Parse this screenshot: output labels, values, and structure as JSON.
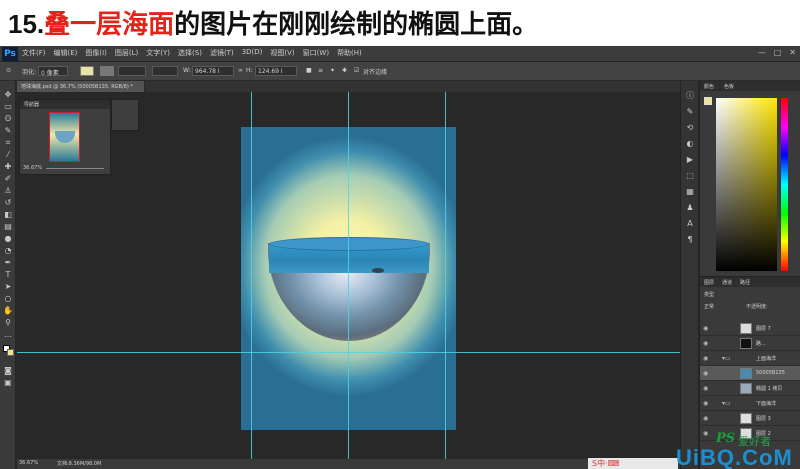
{
  "banner": {
    "number": "15.",
    "highlight": "叠一层海面",
    "rest": "的图片在刚刚绘制的椭圆上面。"
  },
  "app": {
    "logo": "Ps",
    "menu": [
      "文件(F)",
      "编辑(E)",
      "图像(I)",
      "图层(L)",
      "文字(Y)",
      "选择(S)",
      "滤镜(T)",
      "3D(D)",
      "视图(V)",
      "窗口(W)",
      "帮助(H)"
    ],
    "window_controls": [
      "—",
      "□",
      "✕"
    ]
  },
  "options_bar": {
    "style_label": "羽化:",
    "style_value": "0 像素",
    "w_label": "W:",
    "w_value": "964.78 I",
    "h_label": "H:",
    "h_value": "124.69 I",
    "align_label": "对齐边缘"
  },
  "document": {
    "tab_label": "地球海底.psd @ 36.7% (50005B135, RGB/8) *"
  },
  "navigator": {
    "title": "导航器",
    "zoom": "36.67%"
  },
  "color_panel": {
    "tabs": [
      "颜色",
      "色板"
    ]
  },
  "layers_panel": {
    "tabs": [
      "图层",
      "通道",
      "路径"
    ],
    "kind_label": "类型",
    "blend_mode": "正常",
    "opacity_label": "不透明度:",
    "rows": [
      {
        "name": "图层 7",
        "group": false
      },
      {
        "name": "路...",
        "group": false
      },
      {
        "name": "上面海洋",
        "group": true
      },
      {
        "name": "50005B135",
        "group": false
      },
      {
        "name": "椭圆 1 拷贝",
        "group": false
      },
      {
        "name": "下面海洋",
        "group": true
      },
      {
        "name": "图层 3",
        "group": false
      },
      {
        "name": "图层 2",
        "group": false
      }
    ]
  },
  "status_bar": {
    "zoom": "36.67%",
    "doc": "文档:8.36M/98.0M"
  },
  "watermark": {
    "ps": "PS",
    "cn": "爱好者",
    "brand": "UiBQ.CoM"
  }
}
